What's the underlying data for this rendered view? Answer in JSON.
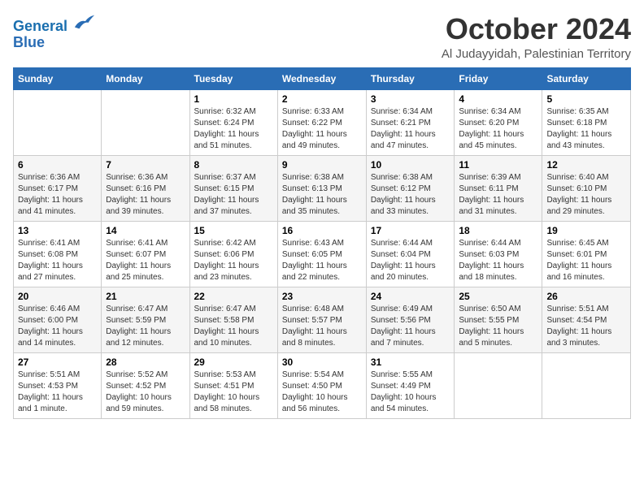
{
  "logo": {
    "line1": "General",
    "line2": "Blue"
  },
  "title": "October 2024",
  "location": "Al Judayyidah, Palestinian Territory",
  "weekdays": [
    "Sunday",
    "Monday",
    "Tuesday",
    "Wednesday",
    "Thursday",
    "Friday",
    "Saturday"
  ],
  "weeks": [
    [
      {
        "day": "",
        "info": ""
      },
      {
        "day": "",
        "info": ""
      },
      {
        "day": "1",
        "info": "Sunrise: 6:32 AM\nSunset: 6:24 PM\nDaylight: 11 hours and 51 minutes."
      },
      {
        "day": "2",
        "info": "Sunrise: 6:33 AM\nSunset: 6:22 PM\nDaylight: 11 hours and 49 minutes."
      },
      {
        "day": "3",
        "info": "Sunrise: 6:34 AM\nSunset: 6:21 PM\nDaylight: 11 hours and 47 minutes."
      },
      {
        "day": "4",
        "info": "Sunrise: 6:34 AM\nSunset: 6:20 PM\nDaylight: 11 hours and 45 minutes."
      },
      {
        "day": "5",
        "info": "Sunrise: 6:35 AM\nSunset: 6:18 PM\nDaylight: 11 hours and 43 minutes."
      }
    ],
    [
      {
        "day": "6",
        "info": "Sunrise: 6:36 AM\nSunset: 6:17 PM\nDaylight: 11 hours and 41 minutes."
      },
      {
        "day": "7",
        "info": "Sunrise: 6:36 AM\nSunset: 6:16 PM\nDaylight: 11 hours and 39 minutes."
      },
      {
        "day": "8",
        "info": "Sunrise: 6:37 AM\nSunset: 6:15 PM\nDaylight: 11 hours and 37 minutes."
      },
      {
        "day": "9",
        "info": "Sunrise: 6:38 AM\nSunset: 6:13 PM\nDaylight: 11 hours and 35 minutes."
      },
      {
        "day": "10",
        "info": "Sunrise: 6:38 AM\nSunset: 6:12 PM\nDaylight: 11 hours and 33 minutes."
      },
      {
        "day": "11",
        "info": "Sunrise: 6:39 AM\nSunset: 6:11 PM\nDaylight: 11 hours and 31 minutes."
      },
      {
        "day": "12",
        "info": "Sunrise: 6:40 AM\nSunset: 6:10 PM\nDaylight: 11 hours and 29 minutes."
      }
    ],
    [
      {
        "day": "13",
        "info": "Sunrise: 6:41 AM\nSunset: 6:08 PM\nDaylight: 11 hours and 27 minutes."
      },
      {
        "day": "14",
        "info": "Sunrise: 6:41 AM\nSunset: 6:07 PM\nDaylight: 11 hours and 25 minutes."
      },
      {
        "day": "15",
        "info": "Sunrise: 6:42 AM\nSunset: 6:06 PM\nDaylight: 11 hours and 23 minutes."
      },
      {
        "day": "16",
        "info": "Sunrise: 6:43 AM\nSunset: 6:05 PM\nDaylight: 11 hours and 22 minutes."
      },
      {
        "day": "17",
        "info": "Sunrise: 6:44 AM\nSunset: 6:04 PM\nDaylight: 11 hours and 20 minutes."
      },
      {
        "day": "18",
        "info": "Sunrise: 6:44 AM\nSunset: 6:03 PM\nDaylight: 11 hours and 18 minutes."
      },
      {
        "day": "19",
        "info": "Sunrise: 6:45 AM\nSunset: 6:01 PM\nDaylight: 11 hours and 16 minutes."
      }
    ],
    [
      {
        "day": "20",
        "info": "Sunrise: 6:46 AM\nSunset: 6:00 PM\nDaylight: 11 hours and 14 minutes."
      },
      {
        "day": "21",
        "info": "Sunrise: 6:47 AM\nSunset: 5:59 PM\nDaylight: 11 hours and 12 minutes."
      },
      {
        "day": "22",
        "info": "Sunrise: 6:47 AM\nSunset: 5:58 PM\nDaylight: 11 hours and 10 minutes."
      },
      {
        "day": "23",
        "info": "Sunrise: 6:48 AM\nSunset: 5:57 PM\nDaylight: 11 hours and 8 minutes."
      },
      {
        "day": "24",
        "info": "Sunrise: 6:49 AM\nSunset: 5:56 PM\nDaylight: 11 hours and 7 minutes."
      },
      {
        "day": "25",
        "info": "Sunrise: 6:50 AM\nSunset: 5:55 PM\nDaylight: 11 hours and 5 minutes."
      },
      {
        "day": "26",
        "info": "Sunrise: 5:51 AM\nSunset: 4:54 PM\nDaylight: 11 hours and 3 minutes."
      }
    ],
    [
      {
        "day": "27",
        "info": "Sunrise: 5:51 AM\nSunset: 4:53 PM\nDaylight: 11 hours and 1 minute."
      },
      {
        "day": "28",
        "info": "Sunrise: 5:52 AM\nSunset: 4:52 PM\nDaylight: 10 hours and 59 minutes."
      },
      {
        "day": "29",
        "info": "Sunrise: 5:53 AM\nSunset: 4:51 PM\nDaylight: 10 hours and 58 minutes."
      },
      {
        "day": "30",
        "info": "Sunrise: 5:54 AM\nSunset: 4:50 PM\nDaylight: 10 hours and 56 minutes."
      },
      {
        "day": "31",
        "info": "Sunrise: 5:55 AM\nSunset: 4:49 PM\nDaylight: 10 hours and 54 minutes."
      },
      {
        "day": "",
        "info": ""
      },
      {
        "day": "",
        "info": ""
      }
    ]
  ]
}
